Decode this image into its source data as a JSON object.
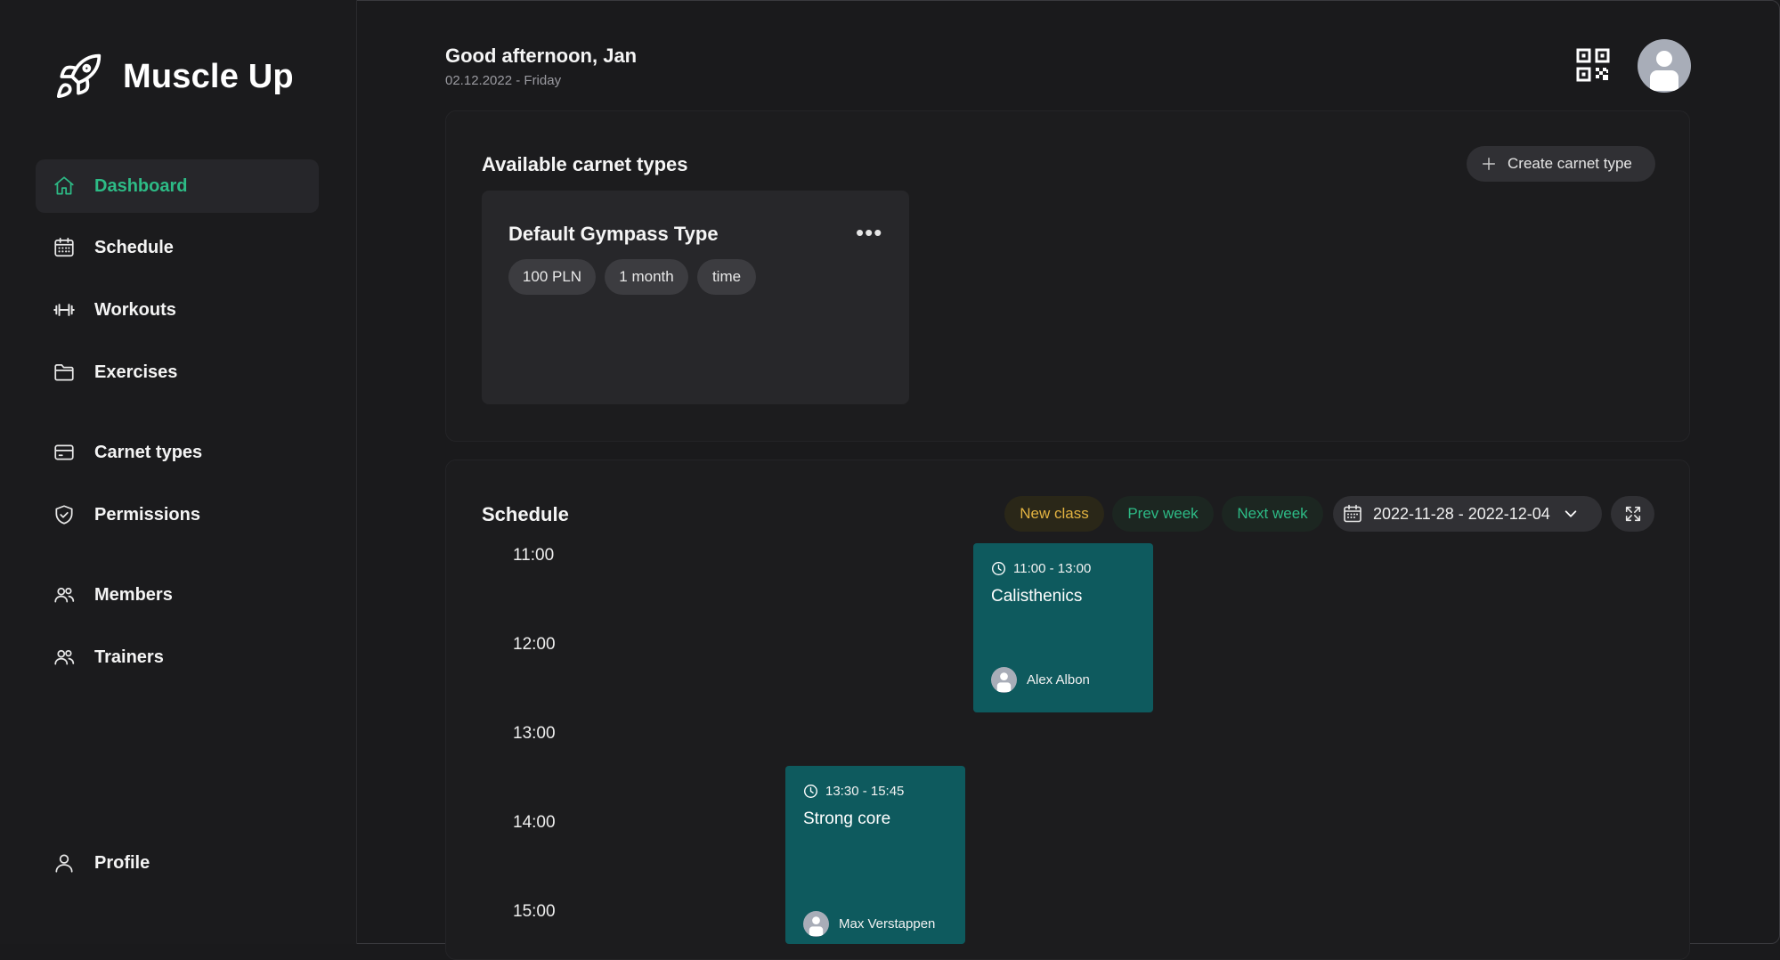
{
  "app": {
    "name": "Muscle Up"
  },
  "sidebar": {
    "items": [
      {
        "label": "Dashboard",
        "icon": "home-icon",
        "active": true
      },
      {
        "label": "Schedule",
        "icon": "calendar-icon"
      },
      {
        "label": "Workouts",
        "icon": "dumbbell-icon"
      },
      {
        "label": "Exercises",
        "icon": "folder-icon"
      },
      {
        "label": "Carnet types",
        "icon": "credit-card-icon"
      },
      {
        "label": "Permissions",
        "icon": "shield-icon"
      },
      {
        "label": "Members",
        "icon": "users-icon"
      },
      {
        "label": "Trainers",
        "icon": "users-icon"
      },
      {
        "label": "Profile",
        "icon": "user-icon"
      }
    ]
  },
  "header": {
    "greeting": "Good afternoon, Jan",
    "date": "02.12.2022 - Friday"
  },
  "carnets": {
    "title": "Available carnet types",
    "create_label": "Create carnet type",
    "cards": [
      {
        "title": "Default Gympass Type",
        "menu": "•••",
        "tags": [
          "100 PLN",
          "1 month",
          "time"
        ]
      }
    ]
  },
  "schedule": {
    "title": "Schedule",
    "new_class_label": "New class",
    "prev_week_label": "Prev week",
    "next_week_label": "Next week",
    "date_range": "2022-11-28 - 2022-12-04",
    "time_labels": [
      "11:00",
      "12:00",
      "13:00",
      "14:00",
      "15:00"
    ],
    "events": [
      {
        "time": "11:00 - 13:00",
        "name": "Calisthenics",
        "trainer": "Alex Albon"
      },
      {
        "time": "13:30 - 15:45",
        "name": "Strong core",
        "trainer": "Max Verstappen"
      }
    ]
  },
  "colors": {
    "accent_green": "#2dbb86",
    "new_class_yellow": "#e3b341",
    "event_teal": "#0e5a5e",
    "background": "#1a1a1c"
  }
}
